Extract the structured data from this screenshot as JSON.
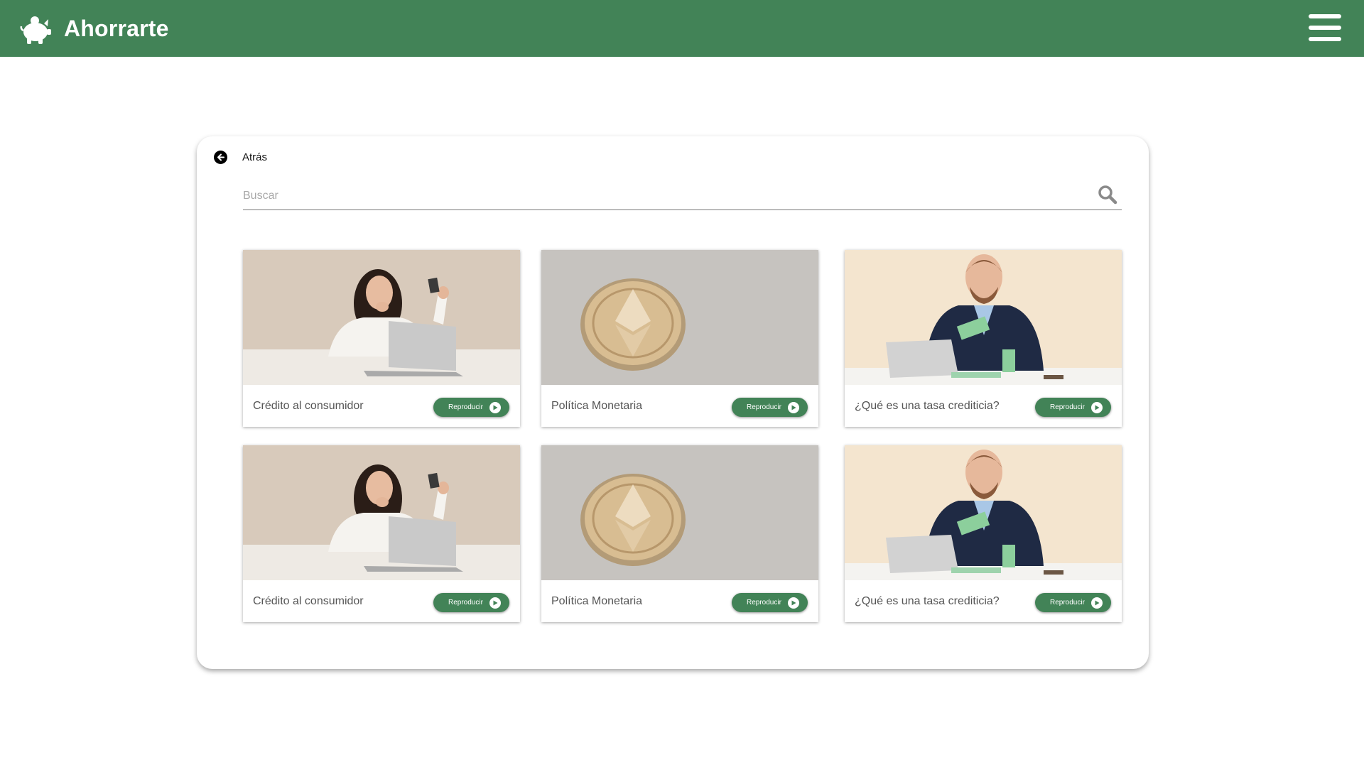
{
  "app": {
    "brand_name": "Ahorrarte",
    "brand_color": "#428357",
    "logo_icon": "piggy-bank-icon",
    "menu_icon": "hamburger-menu-icon"
  },
  "nav": {
    "back_label": "Atrás",
    "back_icon": "arrow-left-circle-icon"
  },
  "search": {
    "placeholder": "Buscar",
    "value": "",
    "icon": "search-icon"
  },
  "videos": [
    {
      "title": "Crédito al consumidor",
      "button_label": "Reproducir",
      "thumbnail": "woman-credit-card-laptop"
    },
    {
      "title": "Política Monetaria",
      "button_label": "Reproducir",
      "thumbnail": "gold-crypto-coin"
    },
    {
      "title": "¿Qué es una tasa crediticia?",
      "button_label": "Reproducir",
      "thumbnail": "man-counting-money"
    },
    {
      "title": "Crédito al consumidor",
      "button_label": "Reproducir",
      "thumbnail": "woman-credit-card-laptop"
    },
    {
      "title": "Política Monetaria",
      "button_label": "Reproducir",
      "thumbnail": "gold-crypto-coin"
    },
    {
      "title": "¿Qué es una tasa crediticia?",
      "button_label": "Reproducir",
      "thumbnail": "man-counting-money"
    }
  ]
}
